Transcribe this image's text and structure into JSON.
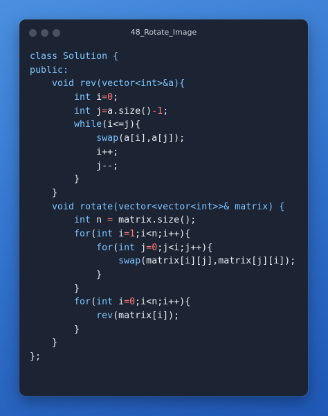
{
  "window": {
    "title": "48_Rotate_Image",
    "controls": [
      "close-dot",
      "minimize-dot",
      "zoom-dot"
    ]
  },
  "editor": {
    "language": "cpp",
    "lines": [
      {
        "indent": 0,
        "tokens": [
          {
            "t": "class",
            "k": "kw"
          },
          {
            "t": " Solution ",
            "k": "kw"
          },
          {
            "t": "{",
            "k": "kw"
          }
        ]
      },
      {
        "indent": 0,
        "tokens": [
          {
            "t": "public",
            "k": "kw"
          },
          {
            "t": ":",
            "k": "kw"
          }
        ]
      },
      {
        "indent": 1,
        "tokens": [
          {
            "t": "void",
            "k": "kw"
          },
          {
            "t": " ",
            "k": "pun"
          },
          {
            "t": "rev",
            "k": "fn"
          },
          {
            "t": "(vector<int>&a){",
            "k": "fn"
          }
        ]
      },
      {
        "indent": 2,
        "tokens": [
          {
            "t": "int",
            "k": "kw"
          },
          {
            "t": " i",
            "k": "id"
          },
          {
            "t": "=",
            "k": "op"
          },
          {
            "t": "0",
            "k": "num"
          },
          {
            "t": ";",
            "k": "pun"
          }
        ]
      },
      {
        "indent": 2,
        "tokens": [
          {
            "t": "int",
            "k": "kw"
          },
          {
            "t": " j",
            "k": "id"
          },
          {
            "t": "=",
            "k": "op"
          },
          {
            "t": "a.size()",
            "k": "id"
          },
          {
            "t": "-",
            "k": "op"
          },
          {
            "t": "1",
            "k": "num"
          },
          {
            "t": ";",
            "k": "pun"
          }
        ]
      },
      {
        "indent": 2,
        "tokens": [
          {
            "t": "while",
            "k": "kw"
          },
          {
            "t": "(i<=j){",
            "k": "id"
          }
        ]
      },
      {
        "indent": 3,
        "tokens": [
          {
            "t": "swap",
            "k": "fn"
          },
          {
            "t": "(a[i],a[j]);",
            "k": "id"
          }
        ]
      },
      {
        "indent": 3,
        "tokens": [
          {
            "t": "i++;",
            "k": "id"
          }
        ]
      },
      {
        "indent": 3,
        "tokens": [
          {
            "t": "j--;",
            "k": "id"
          }
        ]
      },
      {
        "indent": 2,
        "tokens": [
          {
            "t": "}",
            "k": "pun"
          }
        ]
      },
      {
        "indent": 1,
        "tokens": [
          {
            "t": "}",
            "k": "pun"
          }
        ]
      },
      {
        "indent": 1,
        "tokens": [
          {
            "t": "void",
            "k": "kw"
          },
          {
            "t": " ",
            "k": "pun"
          },
          {
            "t": "rotate",
            "k": "fn"
          },
          {
            "t": "(vector<vector<int>>&",
            "k": "fn"
          },
          {
            "t": " matrix) {",
            "k": "fn"
          }
        ]
      },
      {
        "indent": 2,
        "tokens": [
          {
            "t": "int",
            "k": "kw"
          },
          {
            "t": " n ",
            "k": "id"
          },
          {
            "t": "=",
            "k": "op"
          },
          {
            "t": " matrix.size();",
            "k": "id"
          }
        ]
      },
      {
        "indent": 2,
        "tokens": [
          {
            "t": "for",
            "k": "kw"
          },
          {
            "t": "(",
            "k": "pun"
          },
          {
            "t": "int",
            "k": "kw"
          },
          {
            "t": " i",
            "k": "id"
          },
          {
            "t": "=",
            "k": "op"
          },
          {
            "t": "1",
            "k": "num"
          },
          {
            "t": ";i<n;i++){",
            "k": "id"
          }
        ]
      },
      {
        "indent": 3,
        "tokens": [
          {
            "t": "for",
            "k": "kw"
          },
          {
            "t": "(",
            "k": "pun"
          },
          {
            "t": "int",
            "k": "kw"
          },
          {
            "t": " j",
            "k": "id"
          },
          {
            "t": "=",
            "k": "op"
          },
          {
            "t": "0",
            "k": "num"
          },
          {
            "t": ";j<i;j++){",
            "k": "id"
          }
        ]
      },
      {
        "indent": 4,
        "tokens": [
          {
            "t": "swap",
            "k": "fn"
          },
          {
            "t": "(matrix[i][j],matrix[j][i]);",
            "k": "id"
          }
        ]
      },
      {
        "indent": 3,
        "tokens": [
          {
            "t": "}",
            "k": "pun"
          }
        ]
      },
      {
        "indent": 2,
        "tokens": [
          {
            "t": "}",
            "k": "pun"
          }
        ]
      },
      {
        "indent": 2,
        "tokens": [
          {
            "t": "for",
            "k": "kw"
          },
          {
            "t": "(",
            "k": "pun"
          },
          {
            "t": "int",
            "k": "kw"
          },
          {
            "t": " i",
            "k": "id"
          },
          {
            "t": "=",
            "k": "op"
          },
          {
            "t": "0",
            "k": "num"
          },
          {
            "t": ";i<n;i++){",
            "k": "id"
          }
        ]
      },
      {
        "indent": 3,
        "tokens": [
          {
            "t": "rev",
            "k": "fn"
          },
          {
            "t": "(matrix[i]);",
            "k": "id"
          }
        ]
      },
      {
        "indent": 2,
        "tokens": [
          {
            "t": "}",
            "k": "pun"
          }
        ]
      },
      {
        "indent": 1,
        "tokens": [
          {
            "t": "}",
            "k": "pun"
          }
        ]
      },
      {
        "indent": 0,
        "tokens": [
          {
            "t": "};",
            "k": "pun"
          }
        ]
      }
    ]
  },
  "colors": {
    "background": "#2f6fc9",
    "window": "#1c2433",
    "keyword": "#7ec4ff",
    "number": "#ff7b72",
    "text": "#e6edf3"
  }
}
